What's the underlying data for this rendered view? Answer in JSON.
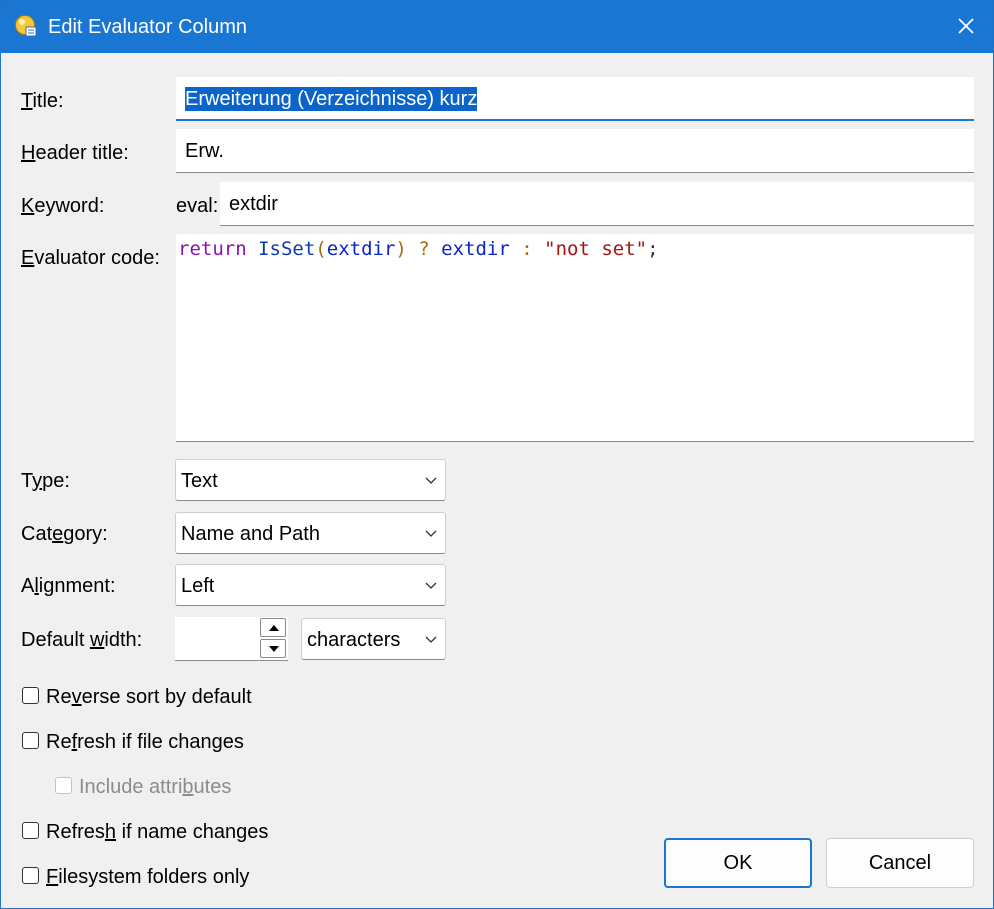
{
  "window": {
    "title": "Edit Evaluator Column"
  },
  "form": {
    "title_label_u": "T",
    "title_label_rest": "itle:",
    "title_value": "Erweiterung (Verzeichnisse) kurz",
    "header_label_u": "H",
    "header_label_rest": "eader title:",
    "header_value": "Erw.",
    "keyword_label_u": "K",
    "keyword_label_rest": "eyword:",
    "keyword_prefix": "eval:",
    "keyword_value": "extdir",
    "code_label_u": "E",
    "code_label_rest": "valuator code:",
    "code": {
      "t1": "return",
      "t2": " ",
      "t3": "IsSet",
      "t4": "(",
      "t5": "extdir",
      "t6": ")",
      "t7": " ? ",
      "t8": "extdir",
      "t9": " : ",
      "t10": "\"not set\"",
      "t11": ";"
    },
    "type_label_a": "T",
    "type_label_u": "y",
    "type_label_b": "pe:",
    "type_value": "Text",
    "category_label_a": "Cat",
    "category_label_u": "e",
    "category_label_b": "gory:",
    "category_value": "Name and Path",
    "alignment_label_a": "A",
    "alignment_label_u": "l",
    "alignment_label_b": "ignment:",
    "alignment_value": "Left",
    "width_label_a": "Default ",
    "width_label_u": "w",
    "width_label_b": "idth:",
    "width_value": "",
    "width_unit": "characters"
  },
  "options": {
    "reverse_a": "Re",
    "reverse_u": "v",
    "reverse_b": "erse sort by default",
    "refresh_file_a": "Re",
    "refresh_file_u": "f",
    "refresh_file_b": "resh if file changes",
    "include_attr_a": "Include attri",
    "include_attr_u": "b",
    "include_attr_b": "utes",
    "refresh_name_a": "Refres",
    "refresh_name_u": "h",
    "refresh_name_b": " if name changes",
    "fs_only_u": "F",
    "fs_only_b": "ilesystem folders only"
  },
  "buttons": {
    "ok": "OK",
    "cancel": "Cancel"
  },
  "colors": {
    "accent": "#1976d2",
    "selection": "#0a64c9"
  },
  "icons": {
    "app": "evaluator-app-icon",
    "close": "close-icon",
    "chevron": "chevron-down-icon"
  }
}
